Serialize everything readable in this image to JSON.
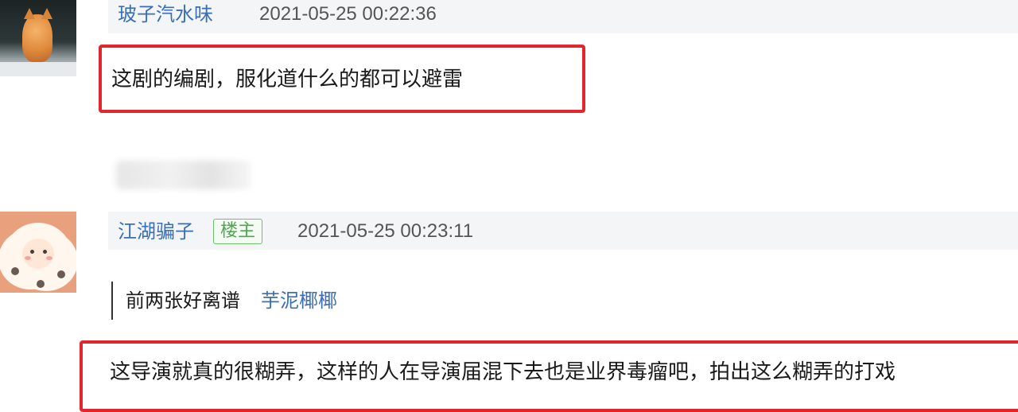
{
  "comments": [
    {
      "username": "玻子汽水味",
      "timestamp": "2021-05-25 00:22:36",
      "text": "这剧的编剧，服化道什么的都可以避雷"
    },
    {
      "username": "江湖骗子",
      "badge": "楼主",
      "timestamp": "2021-05-25 00:23:11",
      "quote": {
        "text": "前两张好离谱",
        "author": "芋泥椰椰"
      },
      "text": "这导演就真的很糊弄，这样的人在导演届混下去也是业界毒瘤吧，拍出这么糊弄的打戏"
    }
  ],
  "colors": {
    "username": "#3a6fb8",
    "highlight_border": "#e3262c",
    "badge_green": "#4ea64e",
    "meta_background": "#f3f5f7"
  }
}
